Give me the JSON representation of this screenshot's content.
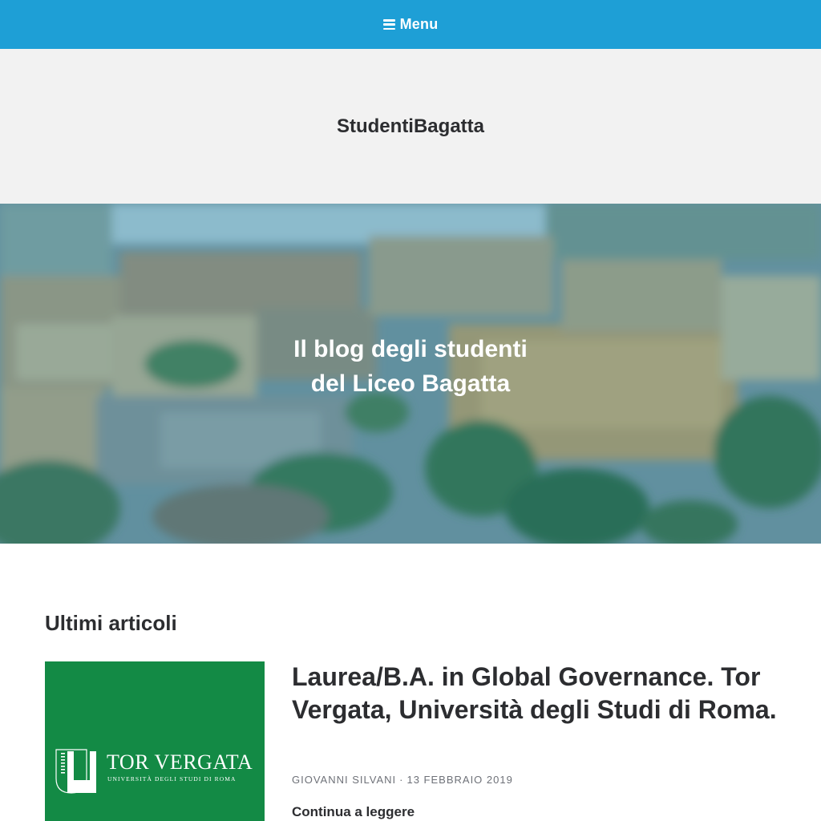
{
  "nav": {
    "menu_label": "Menu",
    "menu_icon": "hamburger-icon",
    "background_color": "#1e9fd6"
  },
  "header": {
    "site_title": "StudentiBagatta"
  },
  "hero": {
    "tagline_line1": "Il blog degli studenti",
    "tagline_line2": "del Liceo Bagatta"
  },
  "main": {
    "section_title": "Ultimi articoli",
    "posts": [
      {
        "title": "Laurea/B.A. in Global Governance. Tor Vergata, Università degli Studi di Roma.",
        "author": "GIOVANNI SILVANI",
        "meta_separator": "·",
        "date": "13 FEBBRAIO 2019",
        "read_more": "Continua a leggere",
        "thumbnail": {
          "logo_name": "TOR VERGATA",
          "logo_subtitle": "UNIVERSITÀ DEGLI STUDI DI ROMA",
          "background_color": "#138a45"
        }
      }
    ]
  }
}
